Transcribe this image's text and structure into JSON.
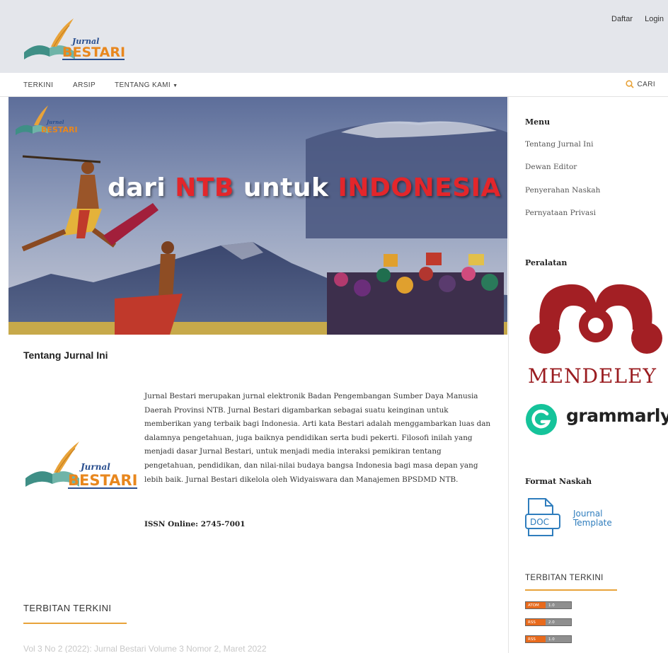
{
  "header": {
    "logo_word1": "Jurnal",
    "logo_word2": "BESTARI",
    "register": "Daftar",
    "login": "Login"
  },
  "nav": {
    "items": [
      "TERKINI",
      "ARSIP",
      "TENTANG KAMI"
    ],
    "search": "CARI"
  },
  "banner": {
    "logo_word1": "Jurnal",
    "logo_word2": "BESTARI",
    "title_part1": "dari",
    "title_part2": "NTB",
    "title_part3": "untuk",
    "title_part4": "INDONESIA"
  },
  "about": {
    "title": "Tentang Jurnal Ini",
    "logo_word1": "Jurnal",
    "logo_word2": "BESTARI",
    "text": "Jurnal Bestari merupakan jurnal elektronik Badan Pengembangan Sumber Daya Manusia Daerah Provinsi NTB. Jurnal Bestari digambarkan sebagai suatu keinginan untuk memberikan yang terbaik bagi Indonesia. Arti kata Bestari adalah menggambarkan luas dan dalamnya pengetahuan, juga baiknya pendidikan serta budi pekerti. Filosofi inilah yang menjadi dasar Jurnal Bestari, untuk menjadi media interaksi pemikiran tentang pengetahuan, pendidikan, dan nilai-nilai budaya bangsa Indonesia bagi masa depan yang lebih baik. Jurnal Bestari dikelola oleh Widyaiswara dan Manajemen BPSDMD NTB.",
    "issn": "ISSN Online: 2745-7001"
  },
  "current_issue": {
    "title": "TERBITAN TERKINI",
    "faded_item": "Vol 3 No 2 (2022): Jurnal Bestari Volume 3 Nomor 2, Maret 2022"
  },
  "sidebar": {
    "menu_title": "Menu",
    "menu_items": [
      "Tentang Jurnal Ini",
      "Dewan Editor",
      "Penyerahan Naskah",
      "Pernyataan Privasi"
    ],
    "tools_title": "Peralatan",
    "mendeley": "MENDELEY",
    "grammarly": "grammarly",
    "format_title": "Format Naskah",
    "doc_label": "DOC",
    "template_line1": "Journal",
    "template_line2": "Template",
    "current_title": "TERBITAN TERKINI",
    "feeds": [
      {
        "type": "ATOM",
        "version": "1.0"
      },
      {
        "type": "RSS",
        "version": "2.0"
      },
      {
        "type": "RSS",
        "version": "1.0"
      }
    ]
  },
  "colors": {
    "accent": "#e8a33a",
    "header_bg": "#e4e6eb",
    "mendeley_red": "#a31f24",
    "grammarly_green": "#15c39a",
    "link_blue": "#2f7dbd"
  }
}
